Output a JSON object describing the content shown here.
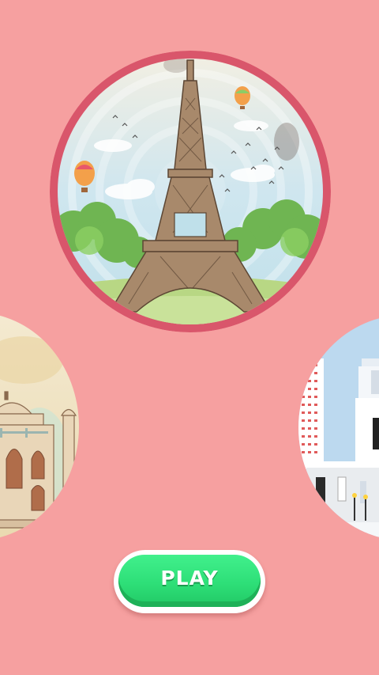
{
  "colors": {
    "background": "#f6a0a0",
    "selected_ring": "#d9566b",
    "play_button": "#33e27d",
    "play_button_border": "#ffffff"
  },
  "level_carousel": {
    "selected_index": 1,
    "items": [
      {
        "landmark": "taj-mahal-image",
        "state": "side"
      },
      {
        "landmark": "eiffel-tower-image",
        "state": "selected"
      },
      {
        "landmark": "city-skyscraper-image",
        "state": "side"
      }
    ]
  },
  "play_button": {
    "label": "PLAY"
  }
}
